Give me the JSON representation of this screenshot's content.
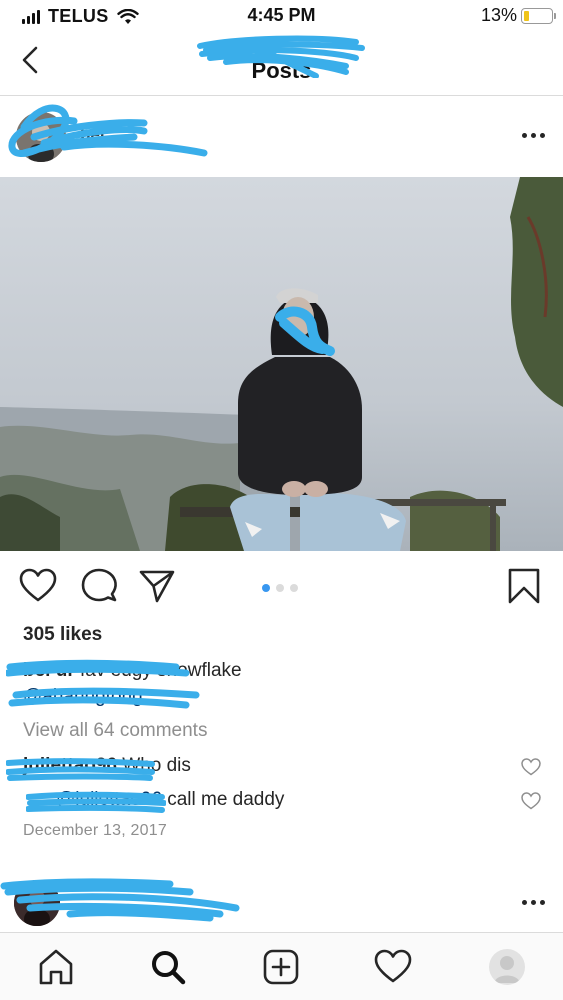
{
  "status_bar": {
    "carrier": "TELUS",
    "time": "4:45 PM",
    "battery_percent": "13%",
    "battery_color": "#f0c419",
    "signal_bars": 4,
    "icons": [
      "signal-icon",
      "wifi-icon",
      "battery-icon"
    ]
  },
  "nav": {
    "title": "Posts",
    "back_icon": "chevron-left-icon"
  },
  "post": {
    "more_icon": "more-horizontal-icon",
    "likes": "305 likes",
    "caption": {
      "text": "fav edgy snowflake",
      "prefix_fragment": "bei ur",
      "mention": "@aharingtong"
    },
    "view_comments": "View all 64 comments",
    "comments": [
      {
        "text": "Who dis"
      },
      {
        "mention": "@juliettao96",
        "text": "call me daddy"
      }
    ],
    "date": "December 13, 2017",
    "carousel": {
      "count": 3,
      "active": 0,
      "active_color": "#3897f0"
    },
    "actions": [
      "heart-icon",
      "comment-icon",
      "share-icon",
      "bookmark-icon"
    ]
  },
  "redaction_color": "#3aaeea",
  "tabbar": {
    "tabs": [
      "home-icon",
      "search-icon",
      "add-post-icon",
      "activity-heart-icon",
      "profile-icon"
    ]
  }
}
